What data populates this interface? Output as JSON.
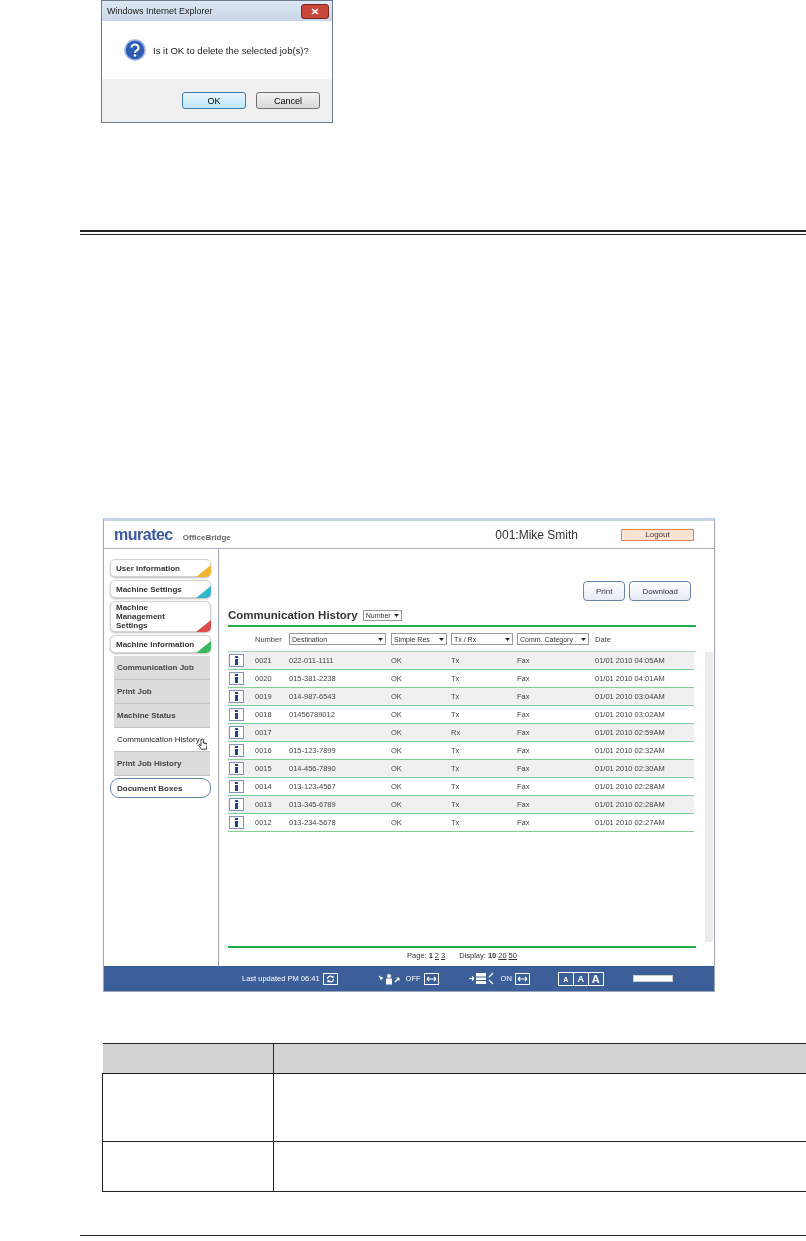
{
  "dialog": {
    "title": "Windows Internet Explorer",
    "message": "Is it OK to delete the selected job(s)?",
    "buttons": [
      {
        "label": "OK",
        "default": true
      },
      {
        "label": "Cancel",
        "default": false
      }
    ]
  },
  "app": {
    "logo": "muratec",
    "product": "OfficeBridge",
    "user": "001:Mike Smith",
    "logout": "Logout",
    "sidebar": [
      {
        "label": "User Information",
        "kind": "section",
        "color": "#f0b533"
      },
      {
        "label": "Machine Settings",
        "kind": "section",
        "color": "#33b5cc"
      },
      {
        "label": "Machine Management Settings",
        "kind": "section",
        "color": "#dd4c4c"
      },
      {
        "label": "Machine Information",
        "kind": "section",
        "color": "#3cb860"
      },
      {
        "label": "Communication Job",
        "kind": "sub",
        "selected": false
      },
      {
        "label": "Print Job",
        "kind": "sub",
        "selected": false
      },
      {
        "label": "Machine Status",
        "kind": "sub",
        "selected": false
      },
      {
        "label": "Communication History",
        "kind": "sub",
        "selected": true
      },
      {
        "label": "Print Job History",
        "kind": "sub",
        "selected": false
      },
      {
        "label": "Document Boxes",
        "kind": "plain"
      }
    ],
    "actions": [
      "Print",
      "Download"
    ],
    "title": "Communication History",
    "sort": "Number",
    "columns": [
      {
        "label": "Number",
        "kind": "text"
      },
      {
        "label": "Destination",
        "kind": "filter"
      },
      {
        "label": "Simple Res",
        "kind": "filter"
      },
      {
        "label": "Tx / Rx",
        "kind": "filter"
      },
      {
        "label": "Comm. Category",
        "kind": "filter"
      },
      {
        "label": "Date",
        "kind": "text"
      }
    ],
    "rows": [
      {
        "number": "0021",
        "destination": "022-011-1111",
        "result": "OK",
        "direction": "Tx",
        "category": "Fax",
        "date": "01/01 2010 04:05AM"
      },
      {
        "number": "0020",
        "destination": "015-381-2238",
        "result": "OK",
        "direction": "Tx",
        "category": "Fax",
        "date": "01/01 2010 04:01AM"
      },
      {
        "number": "0019",
        "destination": "014-987-6543",
        "result": "OK",
        "direction": "Tx",
        "category": "Fax",
        "date": "01/01 2010 03:04AM"
      },
      {
        "number": "0018",
        "destination": "01456789012",
        "result": "OK",
        "direction": "Tx",
        "category": "Fax",
        "date": "01/01 2010 03:02AM"
      },
      {
        "number": "0017",
        "result": "OK",
        "direction": "Rx",
        "category": "Fax",
        "date": "01/01 2010 02:59AM"
      },
      {
        "number": "0016",
        "destination": "015-123-7899",
        "result": "OK",
        "direction": "Tx",
        "category": "Fax",
        "date": "01/01 2010 02:32AM"
      },
      {
        "number": "0015",
        "destination": "014-456-7890",
        "result": "OK",
        "direction": "Tx",
        "category": "Fax",
        "date": "01/01 2010 02:30AM"
      },
      {
        "number": "0014",
        "destination": "013-123-4567",
        "result": "OK",
        "direction": "Tx",
        "category": "Fax",
        "date": "01/01 2010 02:28AM"
      },
      {
        "number": "0013",
        "destination": "013-345-6789",
        "result": "OK",
        "direction": "Tx",
        "category": "Fax",
        "date": "01/01 2010 02:28AM"
      },
      {
        "number": "0012",
        "destination": "013-234-5678",
        "result": "OK",
        "direction": "Tx",
        "category": "Fax",
        "date": "01/01 2010 02:27AM"
      }
    ],
    "pager": {
      "page_label": "Page:",
      "pages": [
        {
          "label": "1",
          "selected": true
        },
        {
          "label": "2",
          "selected": false
        },
        {
          "label": "3",
          "selected": false
        }
      ],
      "display_label": "Display:",
      "sizes": [
        {
          "label": "10",
          "selected": true
        },
        {
          "label": "20",
          "selected": false
        },
        {
          "label": "50",
          "selected": false
        }
      ]
    },
    "status_bar": {
      "last_updated": "Last updated PM 06:41",
      "forwarding": "OFF",
      "fax_forwarding": "ON",
      "font_sizes": [
        "A",
        "A",
        "A"
      ],
      "progress": {
        "level": 1
      }
    }
  }
}
